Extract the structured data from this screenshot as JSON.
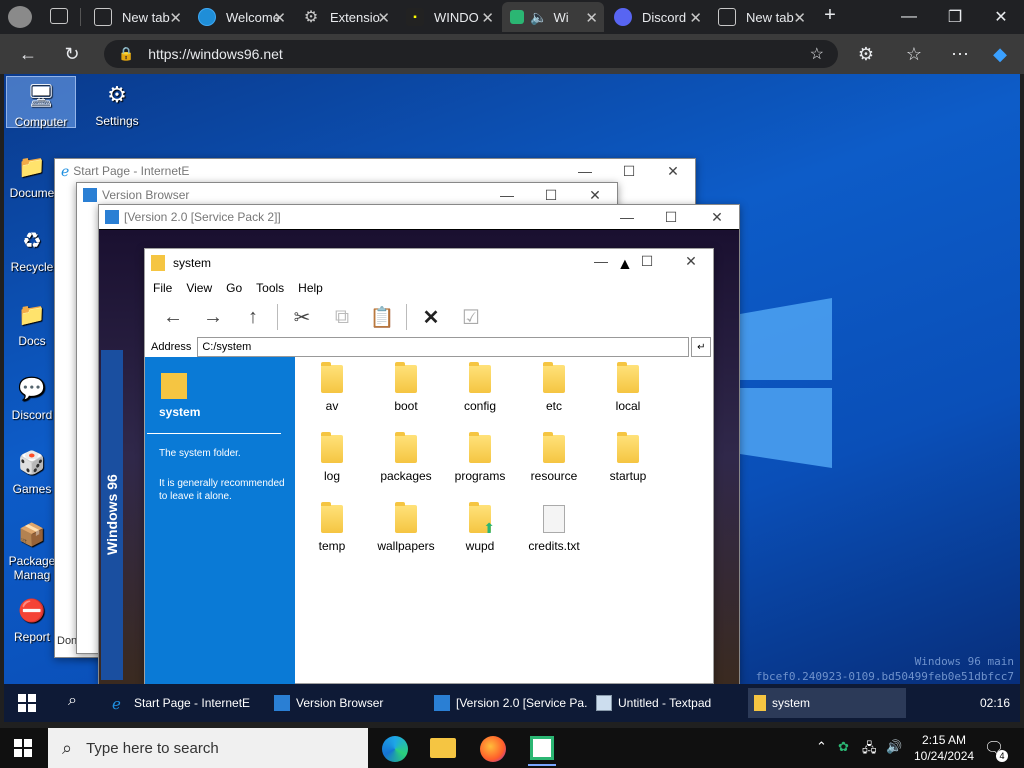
{
  "browser": {
    "tabs": [
      {
        "label": "New tab",
        "icon": "new-tab-icon"
      },
      {
        "label": "Welcome",
        "icon": "edge-icon"
      },
      {
        "label": "Extensio",
        "icon": "extensions-icon"
      },
      {
        "label": "WINDO",
        "icon": "app-icon"
      },
      {
        "label": "Wi",
        "icon": "windows96-icon"
      },
      {
        "label": "Discord",
        "icon": "discord-icon"
      },
      {
        "label": "New tab",
        "icon": "new-tab-icon"
      }
    ],
    "url": "https://windows96.net",
    "accent": "#202124"
  },
  "desktop": {
    "icons": [
      {
        "label": "Computer",
        "icon": "computer-icon"
      },
      {
        "label": "Settings",
        "icon": "settings-icon"
      },
      {
        "label": "Docume",
        "icon": "folder-icon"
      },
      {
        "label": "Recycle",
        "icon": "recycle-bin-icon"
      },
      {
        "label": "Docs",
        "icon": "folder-icon"
      },
      {
        "label": "Discord",
        "icon": "discord-icon"
      },
      {
        "label": "Games",
        "icon": "games-icon"
      },
      {
        "label": "Package Manag",
        "icon": "package-icon"
      },
      {
        "label": "Report",
        "icon": "report-icon"
      }
    ],
    "watermark_line1": "Windows 96 main",
    "watermark_line2": "fbcef0.240923-0109.bd50499feb0e51dbfcc7"
  },
  "windows": {
    "ie": {
      "title": "Start Page - InternetE",
      "status": "Done"
    },
    "vb": {
      "title": "Version Browser"
    },
    "v20": {
      "title": "[Version 2.0 [Service Pack 2]]",
      "banner": "Windows 96"
    },
    "system": {
      "title": "system",
      "menu": [
        "File",
        "View",
        "Go",
        "Tools",
        "Help"
      ],
      "address_label": "Address",
      "address_value": "C:/system",
      "side": {
        "heading": "system",
        "desc1": "The system folder.",
        "desc2": "It is generally recommended to leave it alone."
      },
      "files": [
        {
          "name": "av",
          "type": "folder"
        },
        {
          "name": "boot",
          "type": "folder"
        },
        {
          "name": "config",
          "type": "folder"
        },
        {
          "name": "etc",
          "type": "folder"
        },
        {
          "name": "local",
          "type": "folder"
        },
        {
          "name": "log",
          "type": "folder"
        },
        {
          "name": "packages",
          "type": "folder"
        },
        {
          "name": "programs",
          "type": "folder"
        },
        {
          "name": "resource",
          "type": "folder"
        },
        {
          "name": "startup",
          "type": "folder"
        },
        {
          "name": "temp",
          "type": "folder"
        },
        {
          "name": "wallpapers",
          "type": "folder"
        },
        {
          "name": "wupd",
          "type": "folder"
        },
        {
          "name": "credits.txt",
          "type": "file"
        }
      ]
    }
  },
  "w96_taskbar": {
    "items": [
      "Start Page - InternetE",
      "Version Browser",
      "[Version 2.0 [Service Pa...",
      "Untitled - Textpad",
      "system"
    ],
    "clock": "02:16"
  },
  "win10_taskbar": {
    "search_placeholder": "Type here to search",
    "time": "2:15 AM",
    "date": "10/24/2024",
    "notification_count": "4"
  }
}
